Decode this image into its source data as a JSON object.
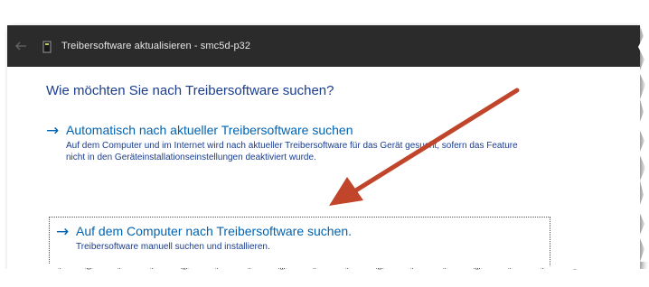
{
  "window": {
    "title": "Treibersoftware aktualisieren - smc5d-p32"
  },
  "heading": "Wie möchten Sie nach Treibersoftware suchen?",
  "options": [
    {
      "arrow": "→",
      "label": "Automatisch nach aktueller Treibersoftware suchen",
      "description": "Auf dem Computer und im Internet wird nach aktueller Treibersoftware für das Gerät gesucht, sofern das Feature nicht in den Geräteinstallationseinstellungen deaktiviert wurde."
    },
    {
      "arrow": "→",
      "label": "Auf dem Computer nach Treibersoftware suchen.",
      "description": "Treibersoftware manuell suchen und installieren."
    }
  ],
  "icons": {
    "back": "back-arrow-icon",
    "device": "device-icon"
  },
  "colors": {
    "titlebar": "#2b2b2b",
    "link": "#0063b1",
    "heading": "#1a3d8f",
    "annotation_arrow": "#c0452a"
  }
}
